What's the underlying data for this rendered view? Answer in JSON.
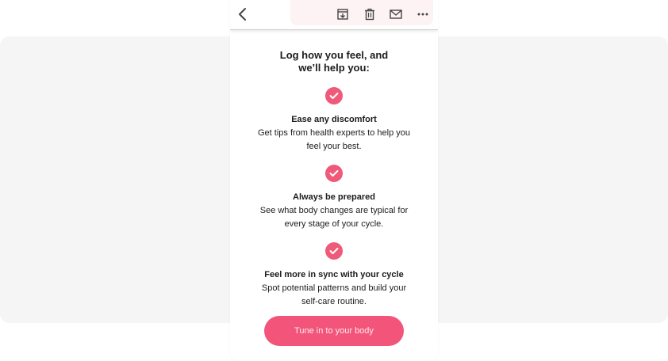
{
  "toolbar": {
    "icons": [
      "back-arrow-icon",
      "archive-icon",
      "trash-icon",
      "mail-icon",
      "more-icon"
    ]
  },
  "colors": {
    "accent": "#f3557a",
    "check": "#ef5a7a",
    "background": "#f5f5f5",
    "text": "#1c1c1c"
  },
  "email": {
    "headline": "Log how you feel, and we’ll help you:",
    "features": [
      {
        "title": "Ease any discomfort",
        "description": "Get tips from health experts to help you feel your best."
      },
      {
        "title": "Always be prepared",
        "description": "See what body changes are typical for every stage of your cycle."
      },
      {
        "title": "Feel more in sync with your cycle",
        "description": "Spot potential patterns and build your self-care routine."
      }
    ],
    "cta_label": "Tune in to your body"
  }
}
